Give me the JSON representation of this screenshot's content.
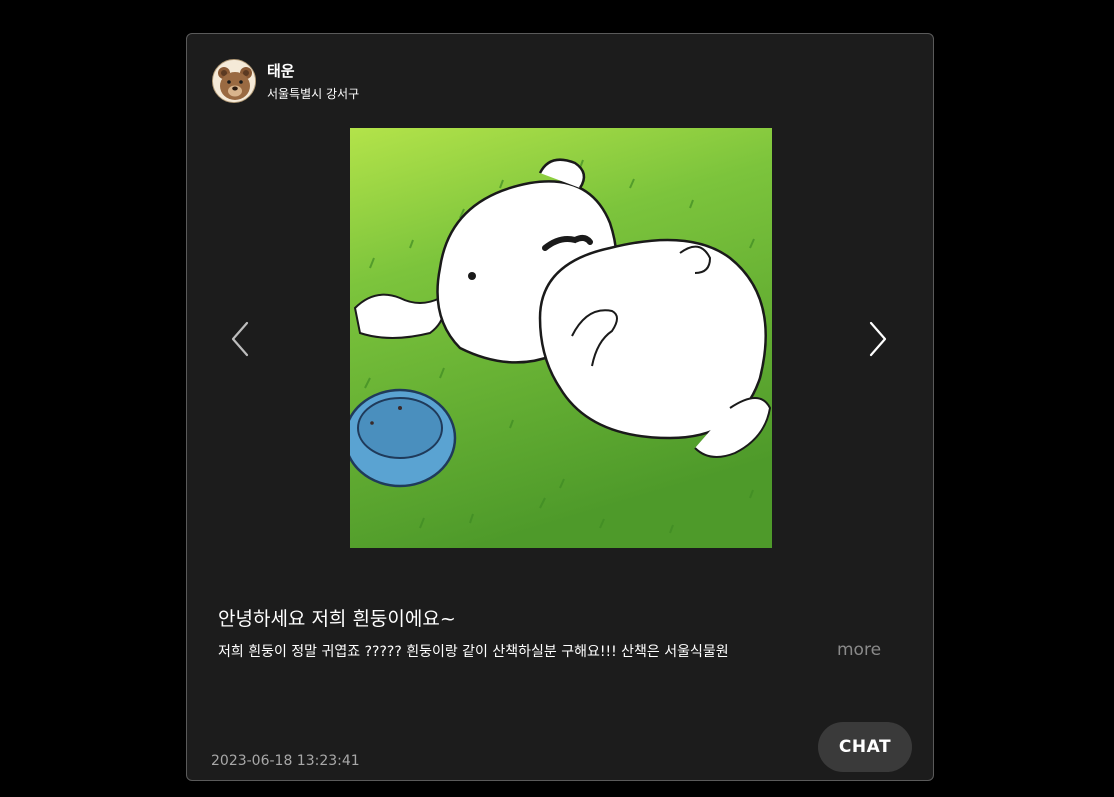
{
  "post": {
    "author": {
      "name": "태운",
      "location": "서울특별시 강서구",
      "avatar_icon": "bear-avatar-icon"
    },
    "image": {
      "description_icon": "white-dog-on-grass-illustration",
      "has_prev": true,
      "has_next": true
    },
    "title": "안녕하세요 저희 흰둥이에요~",
    "body": "저희 흰둥이 정말 귀엽죠 ????? 흰둥이랑 같이 산책하실분 구해요!!! 산책은 서울식물원",
    "more_label": "more",
    "timestamp": "2023-06-18 13:23:41",
    "chat_label": "CHAT"
  },
  "colors": {
    "background": "#000000",
    "card": "#1c1c1c",
    "card_border": "#5a5a5a",
    "chat_button": "#3a3a3a",
    "muted_text": "#8a8a8a",
    "grass": "#5faa2f"
  }
}
